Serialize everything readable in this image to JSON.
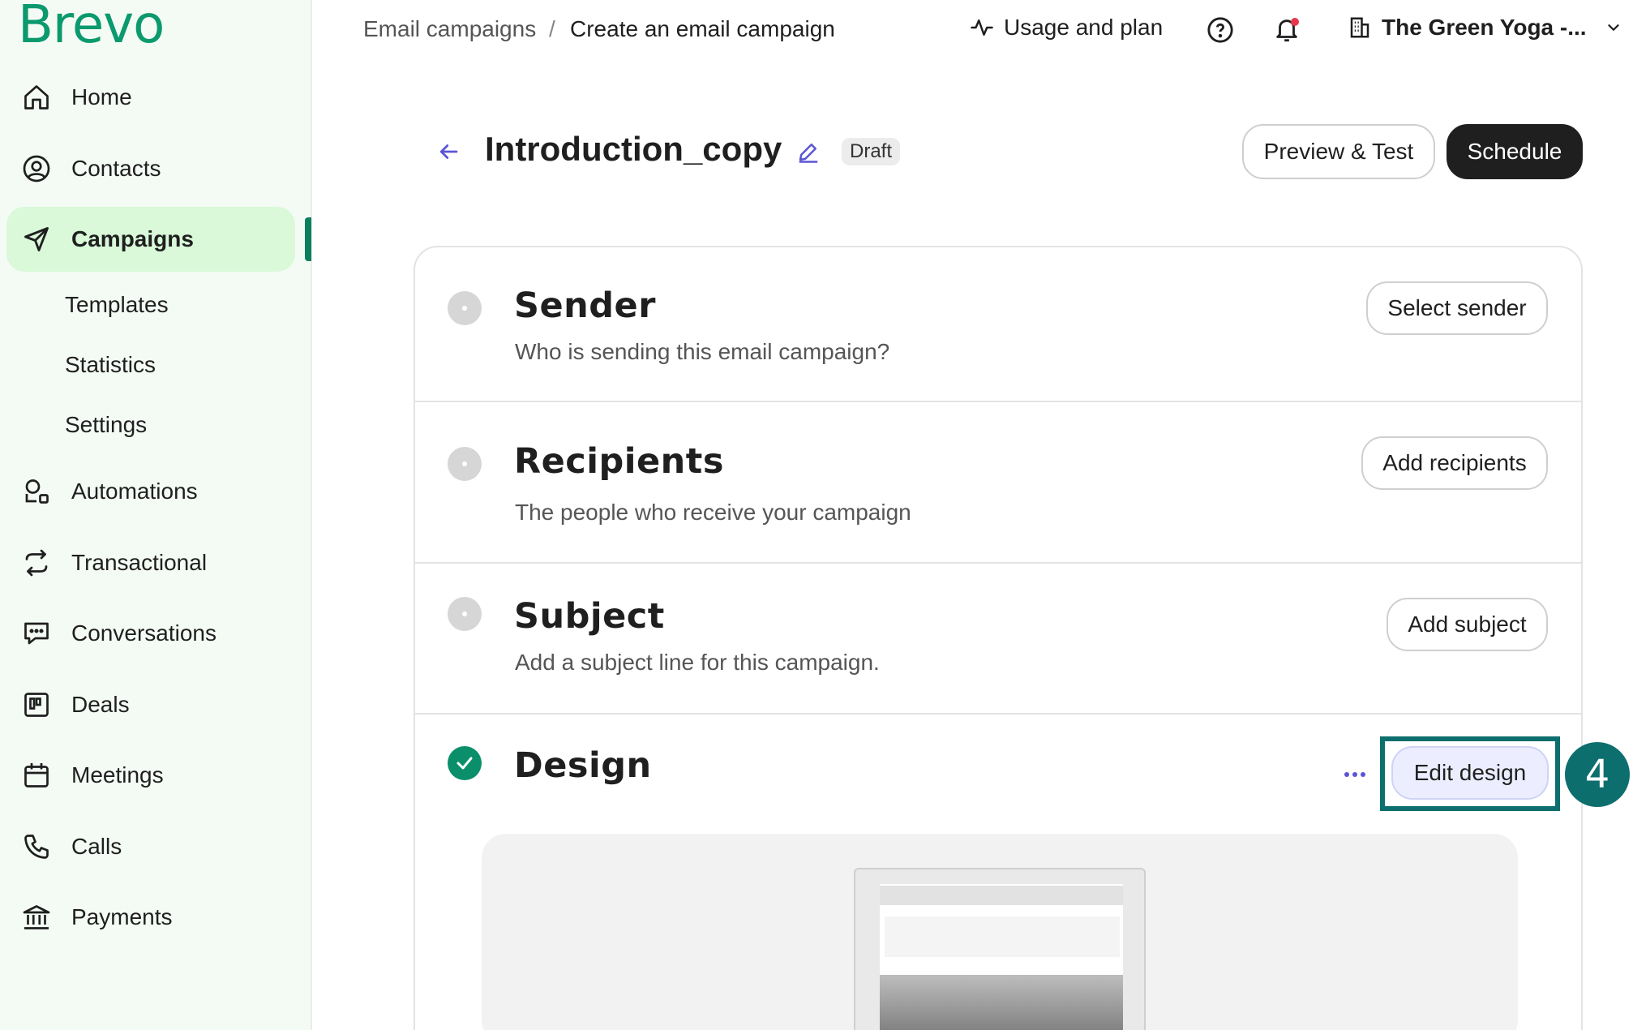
{
  "brand": {
    "logo_text": "Brevo",
    "accent": "#0b996e"
  },
  "sidebar": {
    "items": [
      {
        "label": "Home",
        "icon": "home-icon"
      },
      {
        "label": "Contacts",
        "icon": "contacts-icon"
      },
      {
        "label": "Campaigns",
        "icon": "send-icon",
        "active": true
      },
      {
        "label": "Automations",
        "icon": "automations-icon"
      },
      {
        "label": "Transactional",
        "icon": "transactional-icon"
      },
      {
        "label": "Conversations",
        "icon": "conversations-icon"
      },
      {
        "label": "Deals",
        "icon": "deals-icon"
      },
      {
        "label": "Meetings",
        "icon": "calendar-icon"
      },
      {
        "label": "Calls",
        "icon": "phone-icon"
      },
      {
        "label": "Payments",
        "icon": "bank-icon"
      }
    ],
    "sub_items": [
      "Templates",
      "Statistics",
      "Settings"
    ]
  },
  "topbar": {
    "breadcrumb": [
      "Email campaigns",
      "/",
      "Create an email campaign"
    ],
    "usage_label": "Usage and plan",
    "account_name": "The Green Yoga -..."
  },
  "campaign": {
    "title": "Introduction_copy",
    "status": "Draft",
    "preview_label": "Preview & Test",
    "schedule_label": "Schedule"
  },
  "sections": {
    "sender": {
      "title": "Sender",
      "desc": "Who is sending this email campaign?",
      "action": "Select sender"
    },
    "recipients": {
      "title": "Recipients",
      "desc": "The people who receive your campaign",
      "action": "Add recipients"
    },
    "subject": {
      "title": "Subject",
      "desc": "Add a subject line for this campaign.",
      "action": "Add subject"
    },
    "design": {
      "title": "Design",
      "action": "Edit design",
      "complete": true
    }
  },
  "annotation": {
    "step_number": "4",
    "color": "#0d6e6e"
  }
}
